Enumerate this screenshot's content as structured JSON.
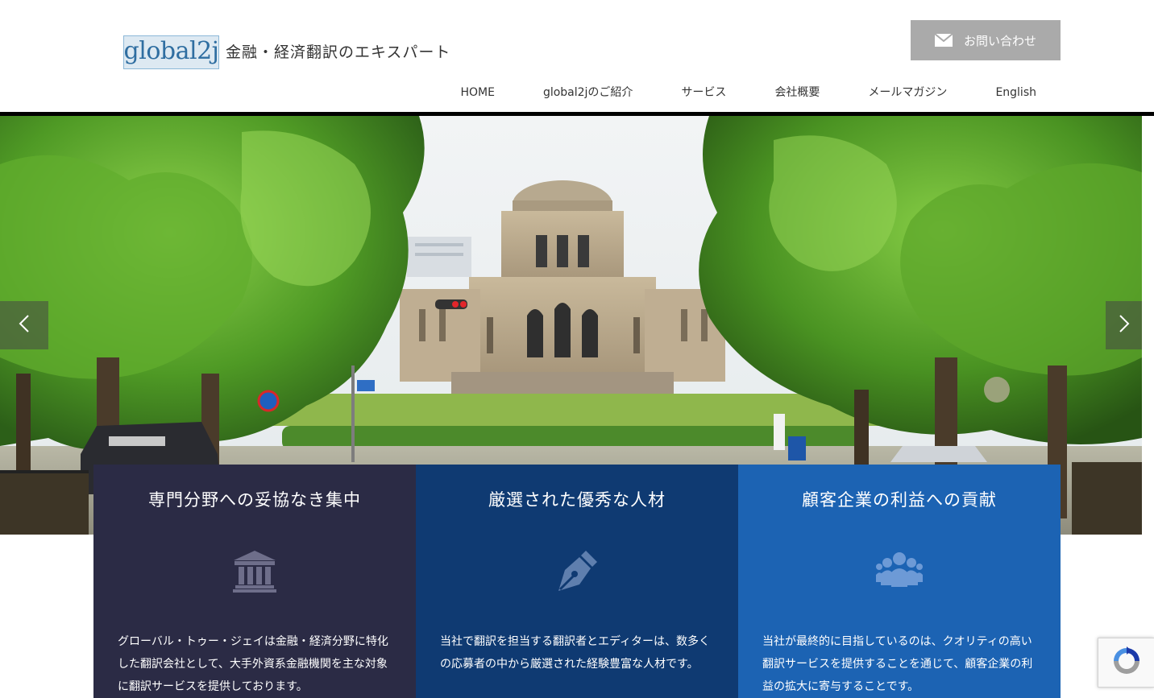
{
  "header": {
    "logo_text": "global2j",
    "tagline": "金融・経済翻訳のエキスパート",
    "contact_label": "お問い合わせ",
    "nav": [
      {
        "label": "HOME"
      },
      {
        "label": "global2jのご紹介"
      },
      {
        "label": "サービス"
      },
      {
        "label": "会社概要"
      },
      {
        "label": "メールマガジン"
      },
      {
        "label": "English"
      }
    ]
  },
  "hero": {
    "prev_icon": "chevron-left-icon",
    "next_icon": "chevron-right-icon"
  },
  "features": [
    {
      "title": "専門分野への妥協なき集中",
      "icon": "bank-icon",
      "color": "#2b2b45",
      "text": "グローバル・トゥー・ジェイは金融・経済分野に特化した翻訳会社として、大手外資系金融機関を主な対象に翻訳サービスを提供しております。"
    },
    {
      "title": "厳選された優秀な人材",
      "icon": "pen-nib-icon",
      "color": "#0f3a72",
      "text": "当社で翻訳を担当する翻訳者とエディターは、数多くの応募者の中から厳選された経験豊富な人材です。"
    },
    {
      "title": "顧客企業の利益への貢献",
      "icon": "users-icon",
      "color": "#1c63b3",
      "text": "当社が最終的に目指しているのは、クオリティの高い翻訳サービスを提供することを通じて、顧客企業の利益の拡大に寄与することです。"
    }
  ],
  "colors": {
    "contact_bg": "#aaaaaa",
    "header_rule": "#000000"
  }
}
